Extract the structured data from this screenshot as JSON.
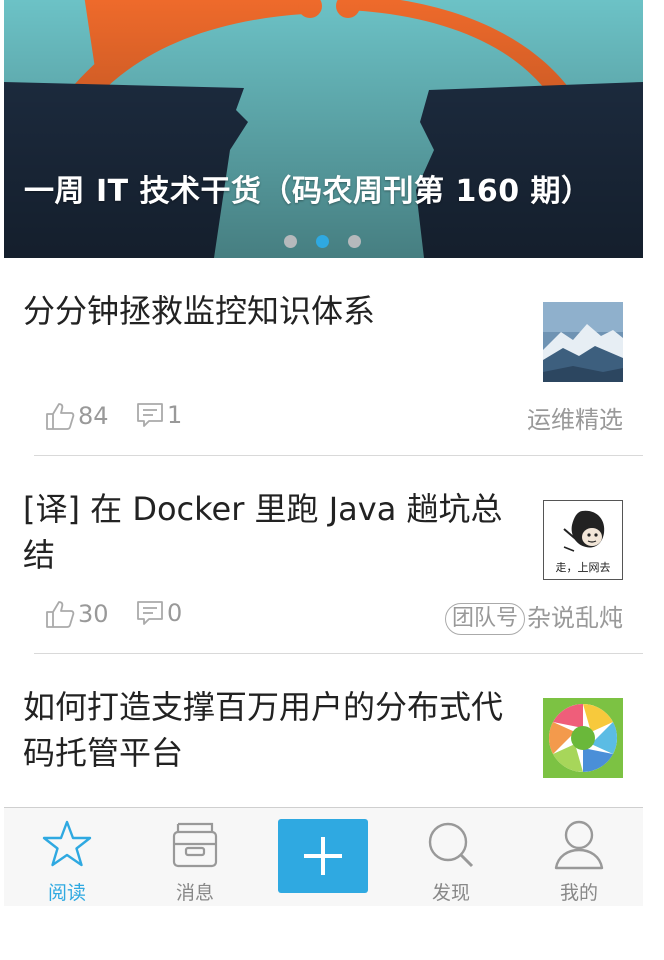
{
  "banner": {
    "title": "一周 IT 技术干货（码农周刊第 160 期）",
    "page_count": 3,
    "active_page": 2
  },
  "articles": [
    {
      "title": "分分钟拯救监控知识体系",
      "likes": "84",
      "comments": "1",
      "badge": "",
      "source": "运维精选",
      "thumb": "mountain-photo"
    },
    {
      "title": "[译] 在 Docker 里跑 Java 趟坑总结",
      "likes": "30",
      "comments": "0",
      "badge": "团队号",
      "source": "杂说乱炖",
      "thumb": "meme-image",
      "thumb_caption": "走，上网去"
    },
    {
      "title": "如何打造支撑百万用户的分布式代码托管平台",
      "likes": "",
      "comments": "",
      "badge": "",
      "source": "",
      "thumb": "shutter-logo"
    }
  ],
  "tabbar": {
    "tabs": [
      {
        "label": "阅读",
        "icon": "star-icon",
        "active": true
      },
      {
        "label": "消息",
        "icon": "inbox-icon",
        "active": false
      },
      {
        "label": "",
        "icon": "plus-icon",
        "active": false
      },
      {
        "label": "发现",
        "icon": "search-icon",
        "active": false
      },
      {
        "label": "我的",
        "icon": "user-icon",
        "active": false
      }
    ]
  },
  "colors": {
    "accent": "#2fa9e1",
    "muted": "#999999",
    "text": "#222222"
  }
}
